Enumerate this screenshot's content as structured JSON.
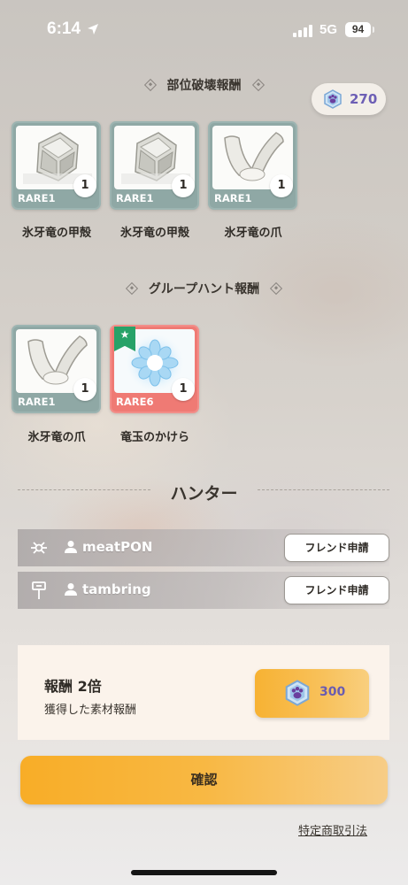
{
  "status_bar": {
    "time": "6:14",
    "network": "5G",
    "battery": "94"
  },
  "currency": {
    "amount": "270",
    "icon": "paw-gem-icon"
  },
  "part_break": {
    "title": "部位破壊報酬",
    "items": [
      {
        "rarity": "RARE1",
        "qty": "1",
        "name": "氷牙竜の甲殻",
        "icon": "ice-shell-icon"
      },
      {
        "rarity": "RARE1",
        "qty": "1",
        "name": "氷牙竜の甲殻",
        "icon": "ice-shell-icon"
      },
      {
        "rarity": "RARE1",
        "qty": "1",
        "name": "氷牙竜の爪",
        "icon": "ice-claw-icon"
      }
    ]
  },
  "group_hunt": {
    "title": "グループハント報酬",
    "items": [
      {
        "rarity": "RARE1",
        "qty": "1",
        "name": "氷牙竜の爪",
        "icon": "ice-claw-icon"
      },
      {
        "rarity": "RARE6",
        "qty": "1",
        "name": "竜玉のかけら",
        "icon": "dragon-gem-icon",
        "badge": "★",
        "color": "#ef7a74"
      }
    ]
  },
  "hunters": {
    "title": "ハンター",
    "list": [
      {
        "name": "meatPON",
        "weapon_icon": "bow-gun-icon",
        "button": "フレンド申請"
      },
      {
        "name": "tambring",
        "weapon_icon": "hammer-icon",
        "button": "フレンド申請"
      }
    ]
  },
  "double_reward": {
    "title": "報酬 2倍",
    "subtitle": "獲得した素材報酬",
    "cost": "300",
    "accent": "#f7b233"
  },
  "confirm_label": "確認",
  "legal_link": "特定商取引法"
}
